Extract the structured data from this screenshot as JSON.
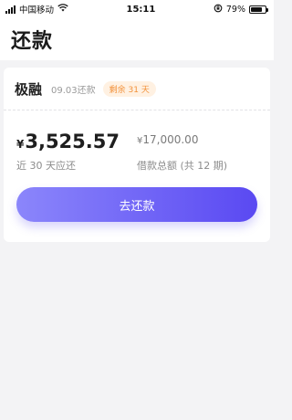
{
  "status_bar": {
    "carrier": "中国移动",
    "time": "15:11",
    "battery_percent": "79%",
    "battery_level": 0.79,
    "icons": [
      "signal-icon",
      "wifi-icon",
      "rotation-lock-icon",
      "battery-icon"
    ]
  },
  "header": {
    "title": "还款"
  },
  "loan_card": {
    "lender": "极融",
    "due_date": "09.03",
    "due_date_suffix": "还款",
    "badge": "剩余 31 天",
    "repay_amount": {
      "currency": "¥",
      "value": "3,525.57",
      "label": "近 30 天应还"
    },
    "total_amount": {
      "currency": "¥",
      "value": "17,000.00",
      "label": "借款总额 (共 12 期)"
    },
    "button_label": "去还款"
  },
  "colors": {
    "badge_text": "#f2913a",
    "badge_bg": "#fff1e2",
    "button_gradient_start": "#8b86fb",
    "button_gradient_end": "#5a49f2",
    "page_bg": "#f3f3f5"
  }
}
